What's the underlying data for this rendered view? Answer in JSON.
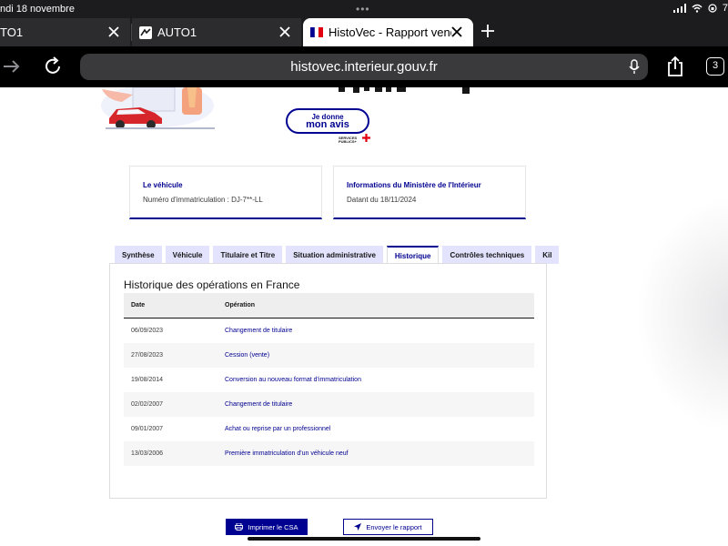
{
  "status_bar": {
    "time": "ndi 18 novembre",
    "battery": "7"
  },
  "tabs": [
    {
      "label": "TO1"
    },
    {
      "label": "AUTO1"
    },
    {
      "label": "HistoVec - Rapport vende"
    }
  ],
  "address": {
    "url": "histovec.interieur.gouv.fr",
    "tab_count": "3"
  },
  "feedback": {
    "line1": "Je donne",
    "line2": "mon avis",
    "sub": "SERVICES PUBLICS+"
  },
  "vehicle_card": {
    "title": "Le véhicule",
    "text": "Numéro d'immatriculation : DJ-7**-LL"
  },
  "ministry_card": {
    "title": "Informations du Ministère de l'Intérieur",
    "text": "Datant du 18/11/2024"
  },
  "content_tabs": [
    {
      "label": "Synthèse"
    },
    {
      "label": "Véhicule"
    },
    {
      "label": "Titulaire et Titre"
    },
    {
      "label": "Situation administrative"
    },
    {
      "label": "Historique"
    },
    {
      "label": "Contrôles techniques"
    },
    {
      "label": "Kil"
    }
  ],
  "history": {
    "title": "Historique des opérations en France",
    "col_date": "Date",
    "col_op": "Opération",
    "rows": [
      {
        "date": "06/09/2023",
        "op": "Changement de titulaire"
      },
      {
        "date": "27/08/2023",
        "op": "Cession (vente)"
      },
      {
        "date": "19/08/2014",
        "op": "Conversion au nouveau format d'immatriculation"
      },
      {
        "date": "02/02/2007",
        "op": "Changement de titulaire"
      },
      {
        "date": "09/01/2007",
        "op": "Achat ou reprise par un professionnel"
      },
      {
        "date": "13/03/2006",
        "op": "Première immatriculation d'un véhicule neuf"
      }
    ]
  },
  "actions": {
    "print": "Imprimer le CSA",
    "send": "Envoyer le rapport"
  },
  "colors": {
    "dsfr_blue": "#000091",
    "tab_bg": "#e3e3fd",
    "browser_chrome": "#1c1c1e"
  },
  "icons": [
    "back-arrow-icon",
    "reload-icon",
    "microphone-icon",
    "share-icon",
    "close-icon",
    "plus-icon",
    "printer-icon",
    "send-icon",
    "wifi-icon",
    "battery-icon"
  ]
}
